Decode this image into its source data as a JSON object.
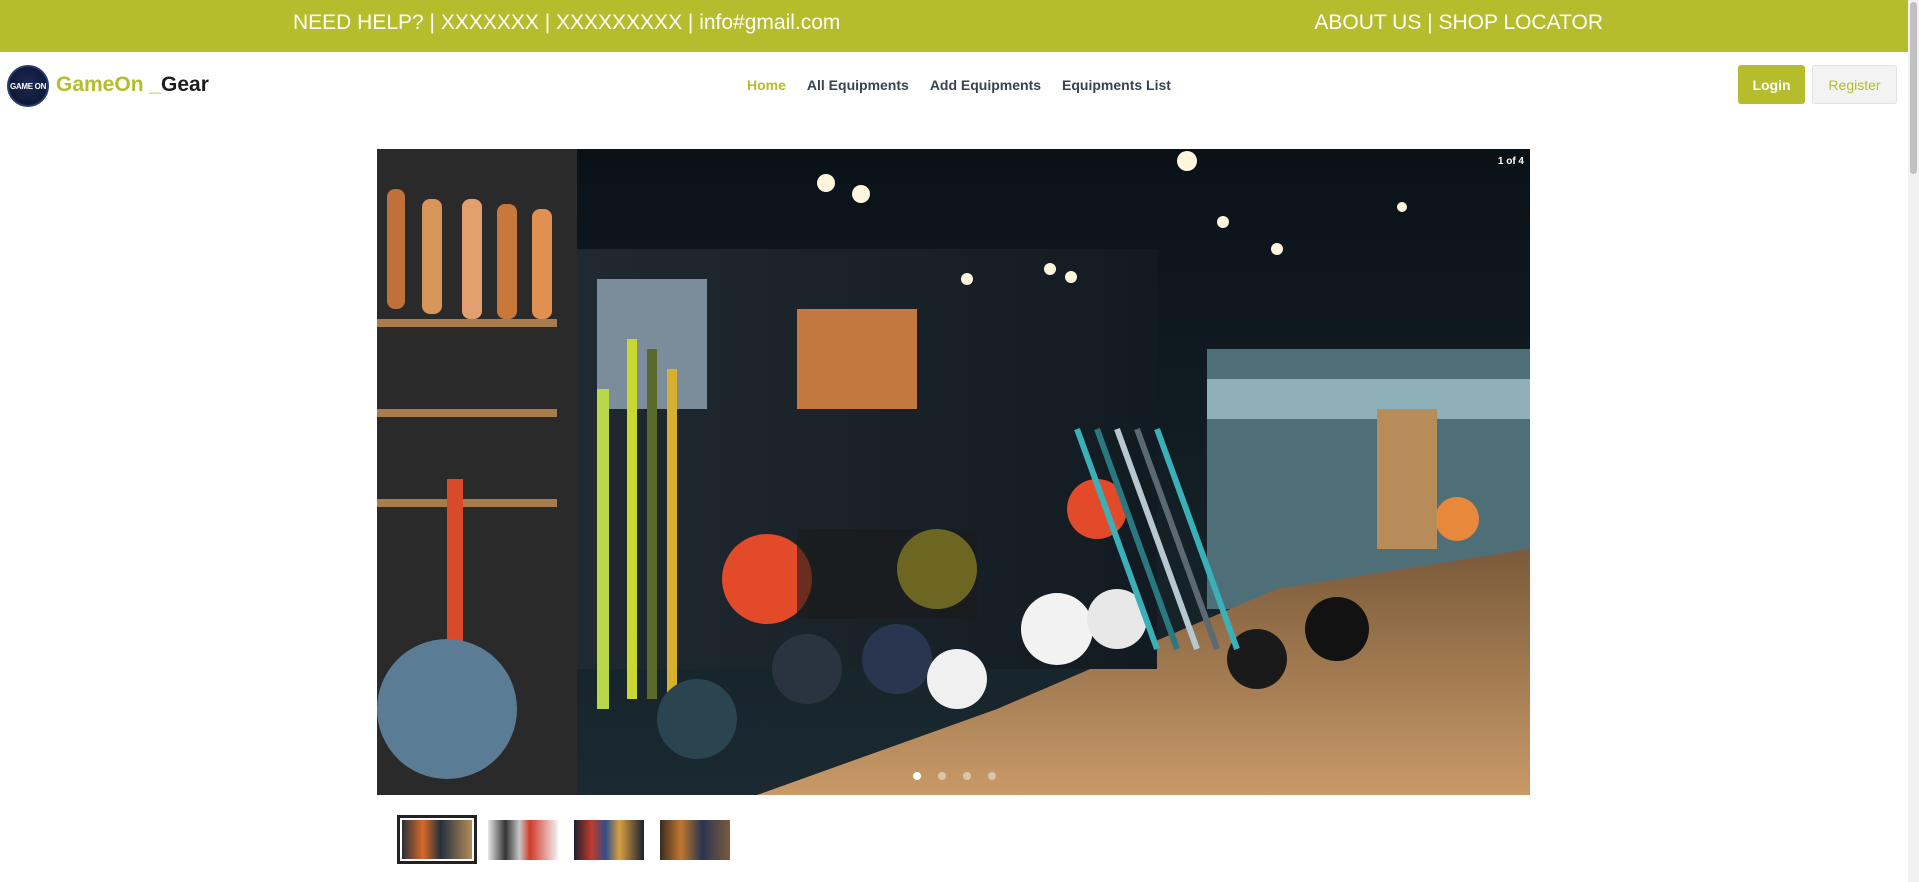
{
  "topbar": {
    "help_text": "NEED HELP? | XXXXXXX | XXXXXXXXX | info#gmail.com",
    "links_text": "ABOUT US | SHOP LOCATOR"
  },
  "brand": {
    "logo_text": "GAME ON",
    "name_part1": "GameOn",
    "name_part2": " _",
    "name_part3": "Gear"
  },
  "nav": {
    "items": [
      {
        "label": "Home",
        "active": true
      },
      {
        "label": "All Equipments",
        "active": false
      },
      {
        "label": "Add Equipments",
        "active": false
      },
      {
        "label": "Equipments List",
        "active": false
      }
    ]
  },
  "auth": {
    "login_label": "Login",
    "register_label": "Register"
  },
  "carousel": {
    "slide_counter": "1 of 4",
    "current_slide": 1,
    "total_slides": 4,
    "image_description": "sports equipment store interior with cricket bats and helmets"
  },
  "colors": {
    "accent": "#b5bd2c",
    "nav_text": "#3a4350"
  }
}
